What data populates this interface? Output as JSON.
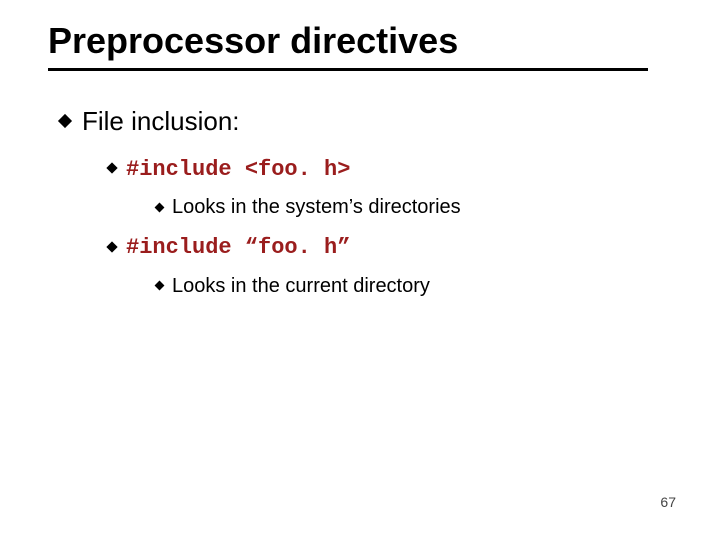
{
  "title": "Preprocessor directives",
  "bullets": {
    "l1_1": "File inclusion:",
    "l2_1": "#include <foo. h>",
    "l3_1": "Looks in the system’s directories",
    "l2_2": "#include “foo. h”",
    "l3_2": "Looks in the current directory"
  },
  "pagenum": "67"
}
